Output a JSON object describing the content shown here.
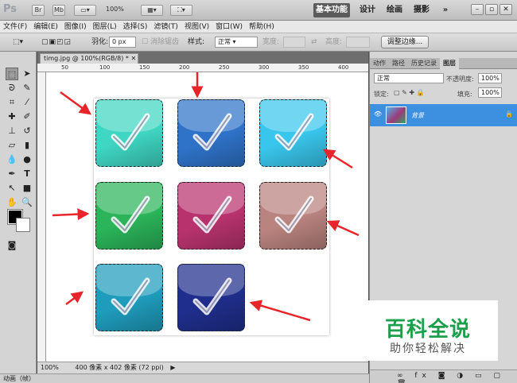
{
  "app": {
    "logo": "Ps",
    "bridge_btn": "Br",
    "minibridge_btn": "Mb",
    "zoom": "100%"
  },
  "workspaces": [
    {
      "label": "基本功能",
      "active": true
    },
    {
      "label": "设计",
      "active": false
    },
    {
      "label": "绘画",
      "active": false
    },
    {
      "label": "摄影",
      "active": false
    }
  ],
  "menu": [
    "文件(F)",
    "编辑(E)",
    "图像(I)",
    "图层(L)",
    "选择(S)",
    "滤镜(T)",
    "视图(V)",
    "窗口(W)",
    "帮助(H)"
  ],
  "options": {
    "feather_label": "羽化:",
    "feather_value": "0 px",
    "antialias_label": "消除锯齿",
    "style_label": "样式:",
    "style_value": "正常",
    "width_label": "宽度:",
    "height_label": "高度:",
    "refine_label": "调整边缘..."
  },
  "document": {
    "tab_title": "timg.jpg @ 100%(RGB/8) *",
    "ruler_labels": [
      "50",
      "100",
      "150",
      "200",
      "250",
      "300",
      "350",
      "400"
    ],
    "status_zoom": "100%",
    "status_info": "400 像素 x 402 像素 (72 ppi)"
  },
  "bottom_label": "动画（帧）",
  "panel": {
    "tabs": [
      {
        "label": "动作",
        "active": false
      },
      {
        "label": "路径",
        "active": false
      },
      {
        "label": "历史记录",
        "active": false
      },
      {
        "label": "图层",
        "active": true
      }
    ],
    "blend_mode": "正常",
    "opacity_label": "不透明度:",
    "opacity_value": "100%",
    "lock_label": "锁定:",
    "fill_label": "填充:",
    "fill_value": "100%",
    "layer_name": "背景"
  },
  "watermark": {
    "line1": "百科全说",
    "line2": "助你轻松解决"
  },
  "colors": {
    "accent": "#3d8fe0",
    "arrow": "#e8252b",
    "check_colors": [
      "#3fd6c3",
      "#2f73c9",
      "#39c6ec",
      "#2bb459",
      "#b8336e",
      "#b9837f",
      "#1f9cbc",
      "#1f2e8c"
    ]
  }
}
